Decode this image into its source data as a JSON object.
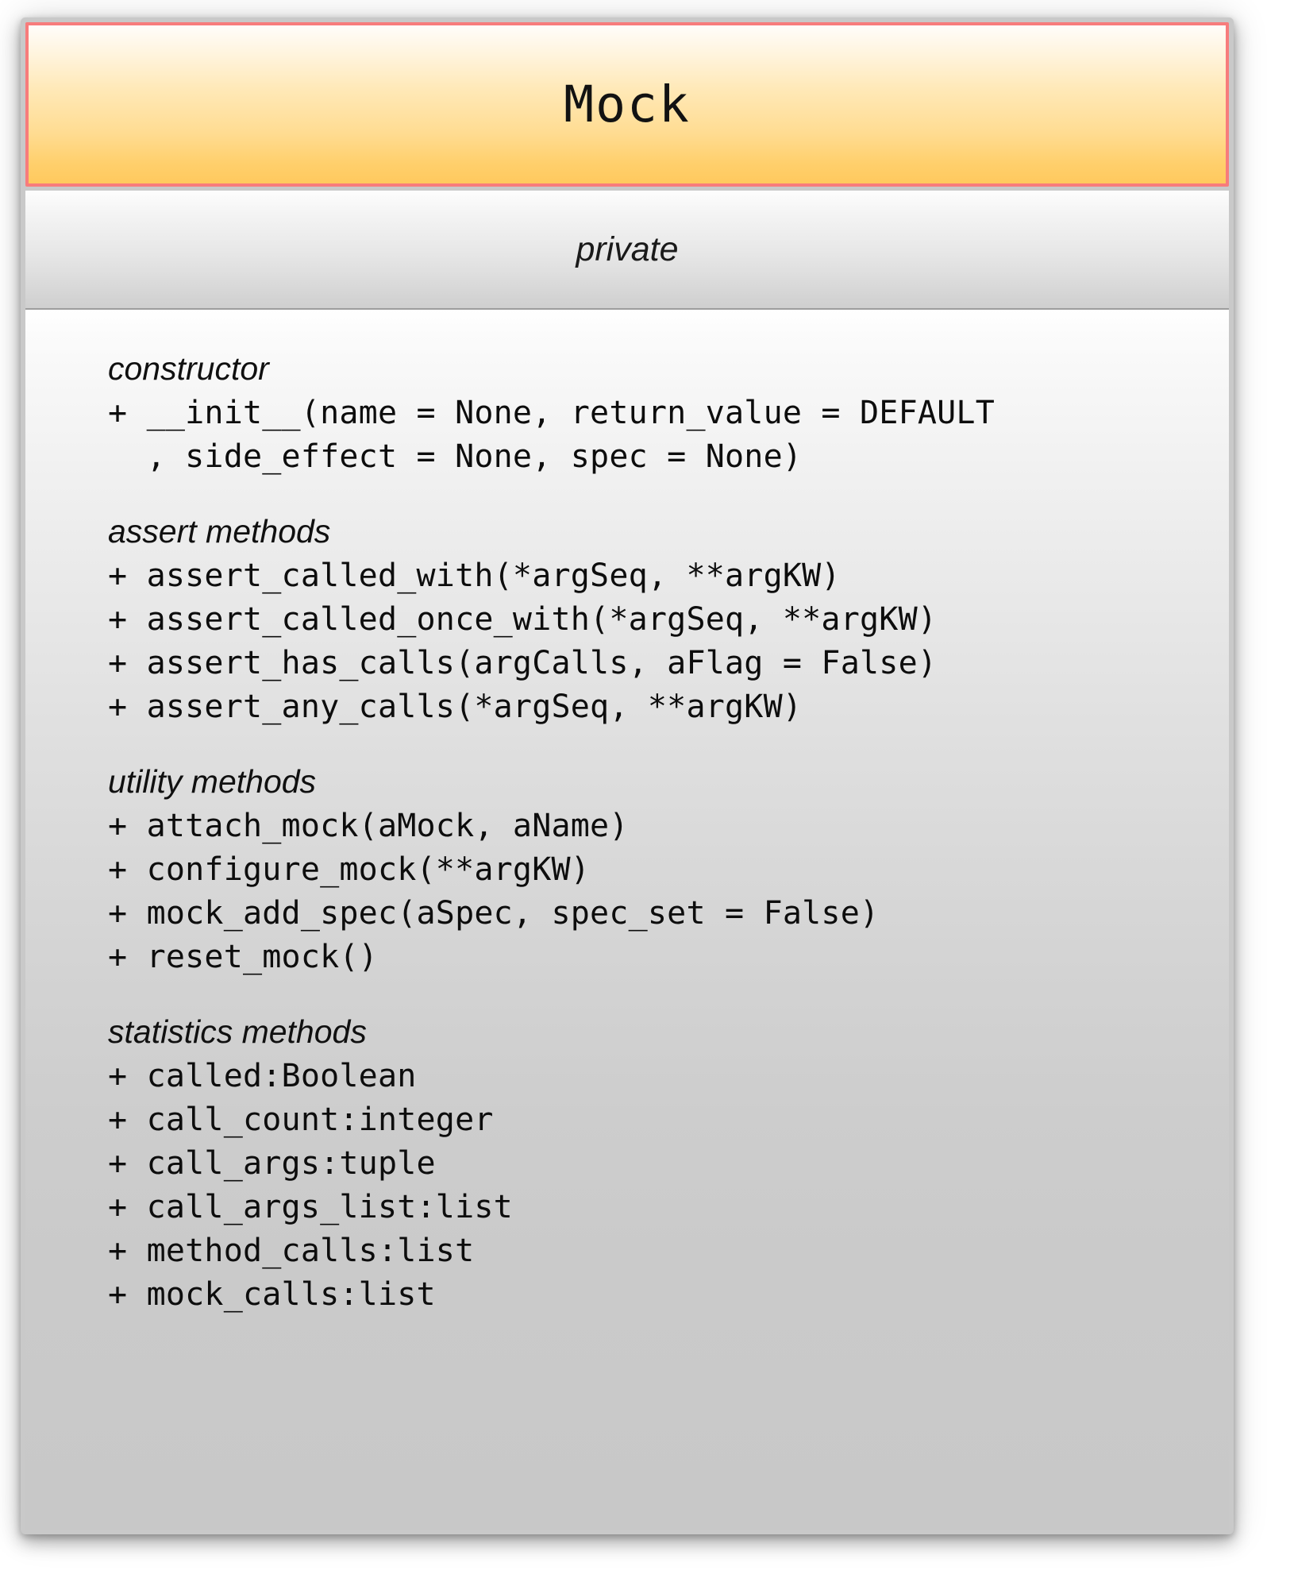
{
  "diagram": {
    "type": "uml-class-diagram",
    "colors": {
      "header_border": "#f77c7c",
      "header_gradient_top": "#fffdfa",
      "header_gradient_bottom": "#ffc95e",
      "body_gradient_top": "#ffffff",
      "body_gradient_bottom": "#c8c8c8",
      "text": "#0d0d0d"
    }
  },
  "class_box": {
    "name": "Mock",
    "stereotype": "private",
    "groups": [
      {
        "title": "constructor",
        "members": [
          {
            "text": "+ __init__(name = None, return_value = DEFAULT",
            "continuation": "  , side_effect = None, spec = None)"
          }
        ]
      },
      {
        "title": "assert methods",
        "members": [
          {
            "text": "+ assert_called_with(*argSeq, **argKW)"
          },
          {
            "text": "+ assert_called_once_with(*argSeq, **argKW)"
          },
          {
            "text": "+ assert_has_calls(argCalls, aFlag = False)"
          },
          {
            "text": "+ assert_any_calls(*argSeq, **argKW)"
          }
        ]
      },
      {
        "title": "utility methods",
        "members": [
          {
            "text": "+ attach_mock(aMock, aName)"
          },
          {
            "text": "+ configure_mock(**argKW)"
          },
          {
            "text": "+ mock_add_spec(aSpec, spec_set = False)"
          },
          {
            "text": "+ reset_mock()"
          }
        ]
      },
      {
        "title": "statistics methods",
        "members": [
          {
            "text": "+ called:Boolean"
          },
          {
            "text": "+ call_count:integer"
          },
          {
            "text": "+ call_args:tuple"
          },
          {
            "text": "+ call_args_list:list"
          },
          {
            "text": "+ method_calls:list"
          },
          {
            "text": "+ mock_calls:list"
          }
        ]
      }
    ]
  }
}
